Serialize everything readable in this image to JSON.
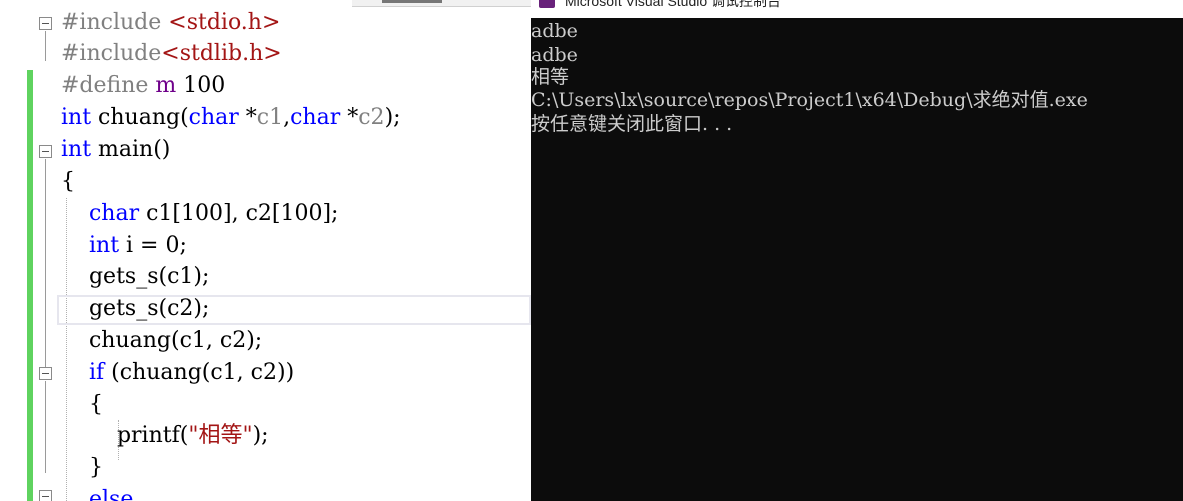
{
  "editor": {
    "lines": [
      [
        {
          "t": "#include ",
          "c": "gray"
        },
        {
          "t": "<stdio.h>",
          "c": "brown"
        }
      ],
      [
        {
          "t": "#include",
          "c": "gray"
        },
        {
          "t": "<stdlib.h>",
          "c": "brown"
        }
      ],
      [
        {
          "t": "#define ",
          "c": "gray"
        },
        {
          "t": "m",
          "c": "purple"
        },
        {
          "t": " 100",
          "c": "black"
        }
      ],
      [
        {
          "t": "int",
          "c": "blue"
        },
        {
          "t": " chuang(",
          "c": "black"
        },
        {
          "t": "char",
          "c": "blue"
        },
        {
          "t": " *",
          "c": "black"
        },
        {
          "t": "c1",
          "c": "gray"
        },
        {
          "t": ",",
          "c": "black"
        },
        {
          "t": "char",
          "c": "blue"
        },
        {
          "t": " *",
          "c": "black"
        },
        {
          "t": "c2",
          "c": "gray"
        },
        {
          "t": ");",
          "c": "black"
        }
      ],
      [
        {
          "t": "int",
          "c": "blue"
        },
        {
          "t": " main()",
          "c": "black"
        }
      ],
      [
        {
          "t": "{",
          "c": "black"
        }
      ],
      [
        {
          "t": "    ",
          "c": "black"
        },
        {
          "t": "char",
          "c": "blue"
        },
        {
          "t": " c1[100], c2[100];",
          "c": "black"
        }
      ],
      [
        {
          "t": "    ",
          "c": "black"
        },
        {
          "t": "int",
          "c": "blue"
        },
        {
          "t": " i = 0;",
          "c": "black"
        }
      ],
      [
        {
          "t": "    gets_s(c1);",
          "c": "black"
        }
      ],
      [
        {
          "t": "    gets_s(c2);",
          "c": "black"
        }
      ],
      [
        {
          "t": "    chuang(c1, c2);",
          "c": "black"
        }
      ],
      [
        {
          "t": "    ",
          "c": "black"
        },
        {
          "t": "if",
          "c": "blue"
        },
        {
          "t": " (chuang(c1, c2))",
          "c": "black"
        }
      ],
      [
        {
          "t": "    {",
          "c": "black"
        }
      ],
      [
        {
          "t": "        printf(",
          "c": "black"
        },
        {
          "t": "\"相等\"",
          "c": "brown"
        },
        {
          "t": ");",
          "c": "black"
        }
      ],
      [
        {
          "t": "    }",
          "c": "black"
        }
      ],
      [
        {
          "t": "    ",
          "c": "black"
        },
        {
          "t": "else",
          "c": "blue"
        }
      ]
    ]
  },
  "console": {
    "title": "Microsoft Visual Studio 调试控制台",
    "output": [
      "adbe",
      "adbe",
      "相等",
      "C:\\Users\\lx\\source\\repos\\Project1\\x64\\Debug\\求绝对值.exe",
      "按任意键关闭此窗口. . ."
    ]
  },
  "colors": {
    "blue": "#0000ff",
    "brown": "#a31515",
    "gray": "#808080",
    "purple": "#6f008a",
    "black": "#000000",
    "console_bg": "#0c0c0c",
    "console_fg": "#cccccc",
    "change_bar": "#5fd35f"
  }
}
